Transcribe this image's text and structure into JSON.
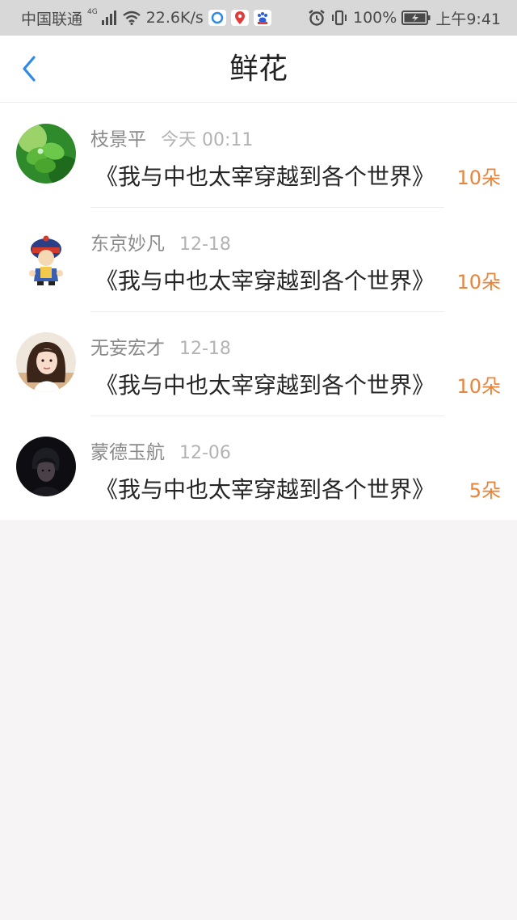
{
  "status_bar": {
    "carrier": "中国联通",
    "network_type": "4G",
    "net_speed": "22.6K/s",
    "battery": "100%",
    "time": "上午9:41"
  },
  "header": {
    "back_icon": "chevron-left-icon",
    "title": "鲜花"
  },
  "colors": {
    "accent_blue": "#2e8ae6",
    "amount_orange": "#e9853b",
    "name_gray": "#8a8a8a",
    "time_gray": "#b3b3b3",
    "page_background": "#f6f4f5"
  },
  "gifts": [
    {
      "name": "枝景平",
      "time": "今天 00:11",
      "message": "《我与中也太宰穿越到各个世界》",
      "amount": "10朵",
      "avatar": "clover-leaf-photo"
    },
    {
      "name": "东京妙凡",
      "time": "12-18",
      "message": "《我与中也太宰穿越到各个世界》",
      "amount": "10朵",
      "avatar": "cartoon-qing-official"
    },
    {
      "name": "无妄宏才",
      "time": "12-18",
      "message": "《我与中也太宰穿越到各个世界》",
      "amount": "10朵",
      "avatar": "girl-portrait-photo"
    },
    {
      "name": "蒙德玉航",
      "time": "12-06",
      "message": "《我与中也太宰穿越到各个世界》",
      "amount": "5朵",
      "avatar": "dark-portrait-photo"
    }
  ]
}
